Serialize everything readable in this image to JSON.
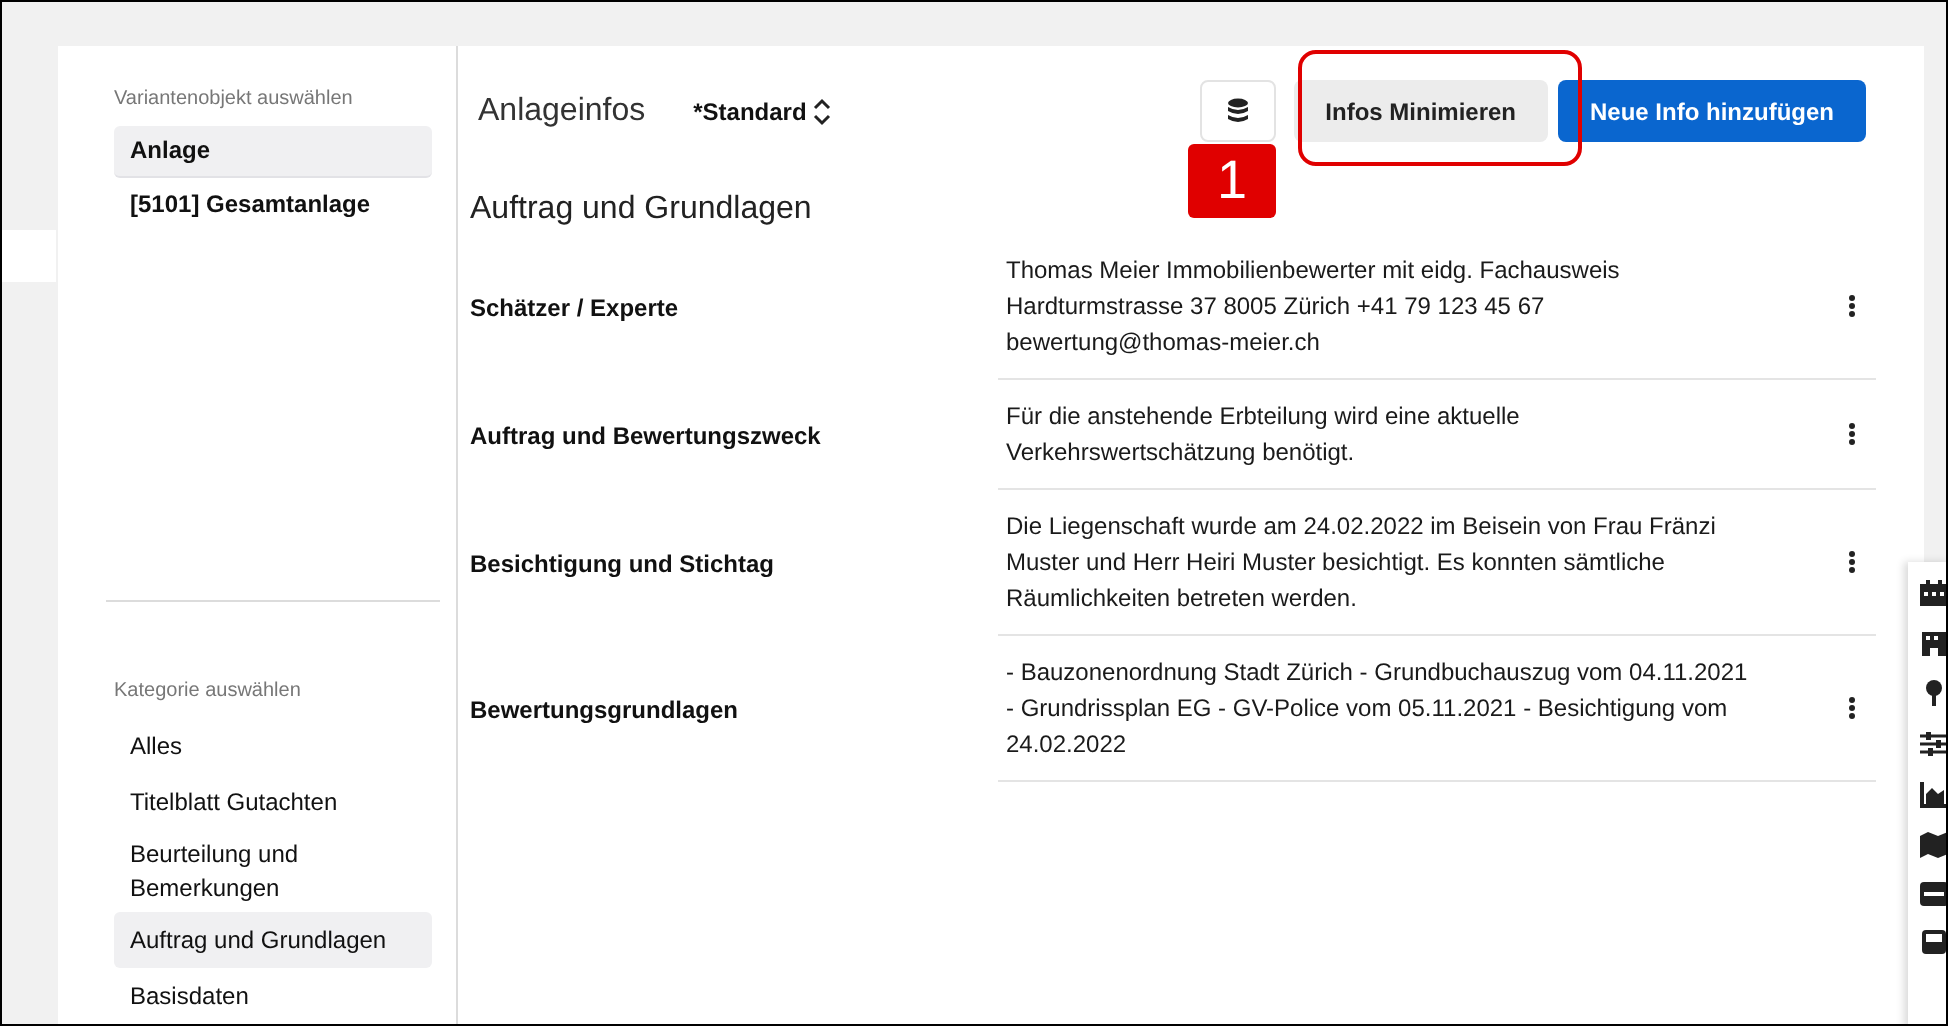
{
  "sidebar": {
    "variant_heading": "Variantenobjekt auswählen",
    "variants": [
      {
        "label": "Anlage",
        "selected": true
      },
      {
        "label": "[5101] Gesamtanlage",
        "selected": false
      }
    ],
    "category_heading": "Kategorie auswählen",
    "categories": [
      {
        "label": "Alles",
        "selected": false
      },
      {
        "label": "Titelblatt Gutachten",
        "selected": false
      },
      {
        "label": "Beurteilung und Bemerkungen",
        "selected": false
      },
      {
        "label": "Auftrag und Grundlagen",
        "selected": true
      },
      {
        "label": "Basisdaten",
        "selected": false
      }
    ]
  },
  "header": {
    "title": "Anlageinfos",
    "view": "*Standard",
    "buttons": [
      {
        "kind": "icon"
      },
      {
        "kind": "secondary",
        "label": "Infos Minimieren"
      },
      {
        "kind": "primary",
        "label": "Neue Info hinzufügen"
      }
    ]
  },
  "section": {
    "title": "Auftrag und Grundlagen",
    "rows": [
      {
        "label": "Schätzer / Experte",
        "text": "Thomas Meier Immobilienbewerter mit eidg. Fachausweis Hardturmstrasse 37 8005 Zürich +41 79 123 45 67 bewertung@thomas-meier.ch"
      },
      {
        "label": "Auftrag und Bewertungszweck",
        "text": "Für die anstehende Erbteilung wird eine aktuelle Verkehrswertschätzung benötigt."
      },
      {
        "label": "Besichtigung und Stichtag",
        "text": "Die Liegenschaft wurde am 24.02.2022 im Beisein von Frau Fränzi Muster und Herr Heiri Muster besichtigt. Es konnten sämtliche Räumlichkeiten betreten werden."
      },
      {
        "label": "Bewertungsgrundlagen",
        "text": "- Bauzonenordnung Stadt Zürich - Grundbuchauszug vom 04.11.2021 - Grundrissplan EG - GV-Police vom 05.11.2021 - Besichtigung vom 24.02.2022"
      }
    ]
  },
  "annotation": {
    "badge": "1"
  }
}
